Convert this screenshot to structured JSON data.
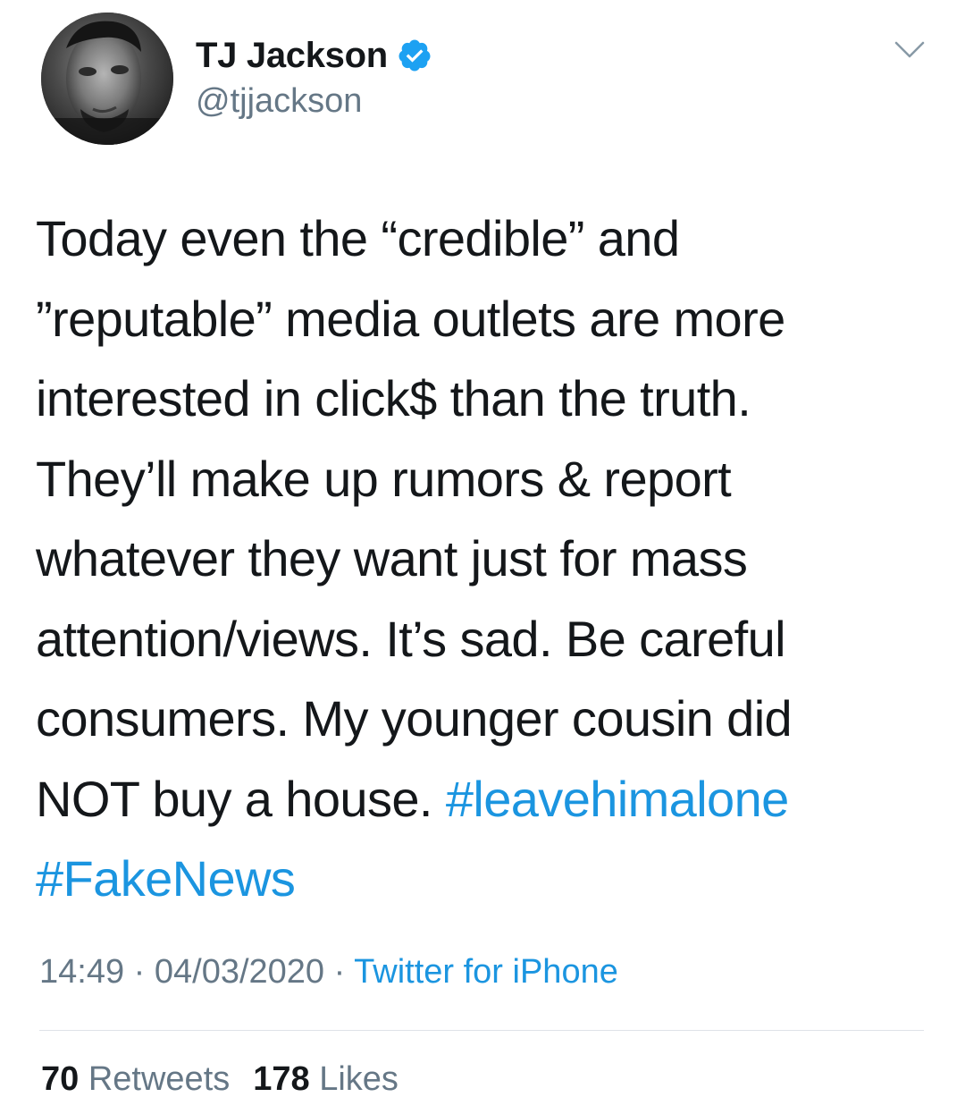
{
  "user": {
    "display_name": "TJ Jackson",
    "handle": "@tjjackson",
    "verified_icon": "verified-badge-icon",
    "avatar_icon": "profile-photo"
  },
  "menu": {
    "icon": "chevron-down-icon"
  },
  "tweet": {
    "lines": [
      "Today even the “credible” and",
      "”reputable” media outlets are more",
      "interested in click$ than the truth.",
      "They’ll make up rumors & report",
      "whatever they want just for mass",
      "attention/views. It’s sad. Be careful",
      "consumers. My younger cousin did",
      "NOT buy a house. "
    ],
    "hashtag_1": "#leavehimalone",
    "hashtag_2": "#FakeNews"
  },
  "meta": {
    "time": "14:49",
    "sep1": " · ",
    "date": "04/03/2020",
    "sep2": " · ",
    "source": "Twitter for iPhone"
  },
  "stats": {
    "retweets_count": "70",
    "retweets_label": "Retweets",
    "likes_count": "178",
    "likes_label": "Likes"
  },
  "colors": {
    "link": "#1b95e0",
    "secondary": "#657786",
    "text": "#14171a",
    "verified": "#1da1f2"
  }
}
